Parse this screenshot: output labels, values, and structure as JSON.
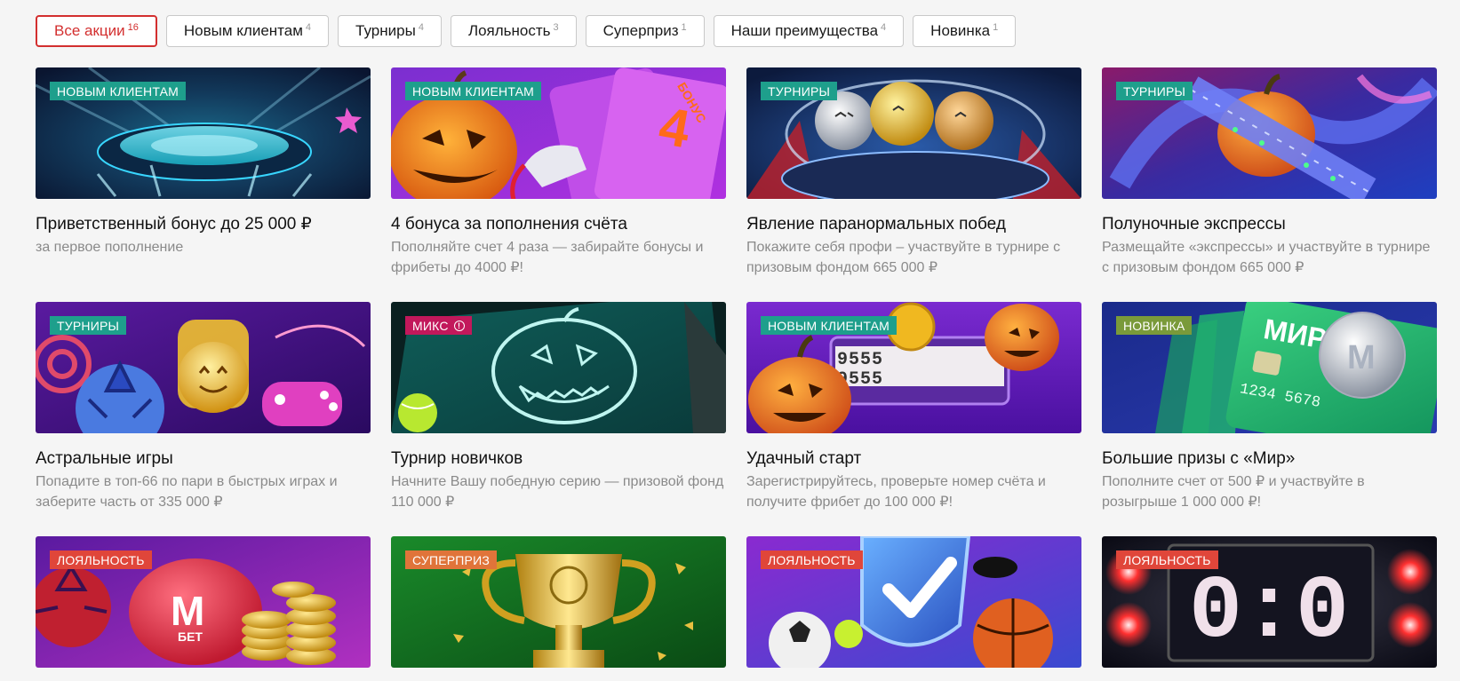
{
  "filters": [
    {
      "label": "Все акции",
      "count": "16",
      "active": true
    },
    {
      "label": "Новым клиентам",
      "count": "4"
    },
    {
      "label": "Турниры",
      "count": "4"
    },
    {
      "label": "Лояльность",
      "count": "3"
    },
    {
      "label": "Суперприз",
      "count": "1"
    },
    {
      "label": "Наши преимущества",
      "count": "4"
    },
    {
      "label": "Новинка",
      "count": "1"
    }
  ],
  "tag_colors": {
    "new_clients": "#1e9f8c",
    "tournaments": "#1e9f8c",
    "mix": "#c2185b",
    "novelty": "#7a9a3a",
    "loyalty": "#e0463a",
    "superprize": "#e0743a"
  },
  "promos": [
    {
      "tag": "НОВЫМ КЛИЕНТАМ",
      "tag_color": "#1e9f8c",
      "title": "Приветственный бонус до 25 000 ₽",
      "desc": "за первое пополнение",
      "image": "stadium-image"
    },
    {
      "tag": "НОВЫМ КЛИЕНТАМ",
      "tag_color": "#1e9f8c",
      "title": "4 бонуса за пополнения счёта",
      "desc": "Пополняйте счет 4 раза — забирайте бонусы и фрибеты до 4000 ₽!",
      "image": "pumpkin-cards-image",
      "art_text": {
        "number": "4",
        "word": "БОНУС"
      }
    },
    {
      "tag": "ТУРНИРЫ",
      "tag_color": "#1e9f8c",
      "title": "Явление паранормальных побед",
      "desc": "Покажите себя профи – участвуйте в турнире с призовым фондом 665 000 ₽",
      "image": "medals-image"
    },
    {
      "tag": "ТУРНИРЫ",
      "tag_color": "#1e9f8c",
      "title": "Полуночные экспрессы",
      "desc": "Размещайте «экспрессы» и участвуйте в турнире с призовым фондом 665 000 ₽",
      "image": "pumpkin-ribbon-image"
    },
    {
      "tag": "ТУРНИРЫ",
      "tag_color": "#1e9f8c",
      "title": "Астральные игры",
      "desc": "Попадите в топ-66 по пари в быстрых играх и заберите часть от 335 000 ₽",
      "image": "games-image"
    },
    {
      "tag": "МИКС",
      "tag_color": "#c2185b",
      "title": "Турнир новичков",
      "desc": "Начните Вашу победную серию — призовой фонд 110 000 ₽",
      "image": "chalk-pumpkin-image",
      "tag_icon": "info-icon"
    },
    {
      "tag": "НОВЫМ КЛИЕНТАМ",
      "tag_color": "#1e9f8c",
      "title": "Удачный старт",
      "desc": "Зарегистрируйтесь, проверьте номер счёта и получите фрибет до 100 000 ₽!",
      "image": "slot-pumpkin-image",
      "art_text": {
        "digits": "9555"
      }
    },
    {
      "tag": "НОВИНКА",
      "tag_color": "#7a9a3a",
      "title": "Большие призы с «Мир»",
      "desc": "Пополните счет от 500 ₽ и участвуйте в розыгрыше 1 000 000 ₽!",
      "image": "mir-card-image",
      "art_text": {
        "brand": "МИР",
        "number": "1234 5678",
        "coin": "M"
      }
    },
    {
      "tag": "ЛОЯЛЬНОСТЬ",
      "tag_color": "#e0463a",
      "title": "",
      "desc": "",
      "image": "piggy-bank-image",
      "art_text": {
        "logo": "M",
        "sub": "БЕТ"
      }
    },
    {
      "tag": "СУПЕРПРИЗ",
      "tag_color": "#e0743a",
      "title": "",
      "desc": "",
      "image": "trophy-image"
    },
    {
      "tag": "ЛОЯЛЬНОСТЬ",
      "tag_color": "#e0463a",
      "title": "",
      "desc": "",
      "image": "shield-check-image"
    },
    {
      "tag": "ЛОЯЛЬНОСТЬ",
      "tag_color": "#e0463a",
      "title": "",
      "desc": "",
      "image": "scoreboard-image",
      "art_text": {
        "score": "0:0"
      }
    }
  ]
}
